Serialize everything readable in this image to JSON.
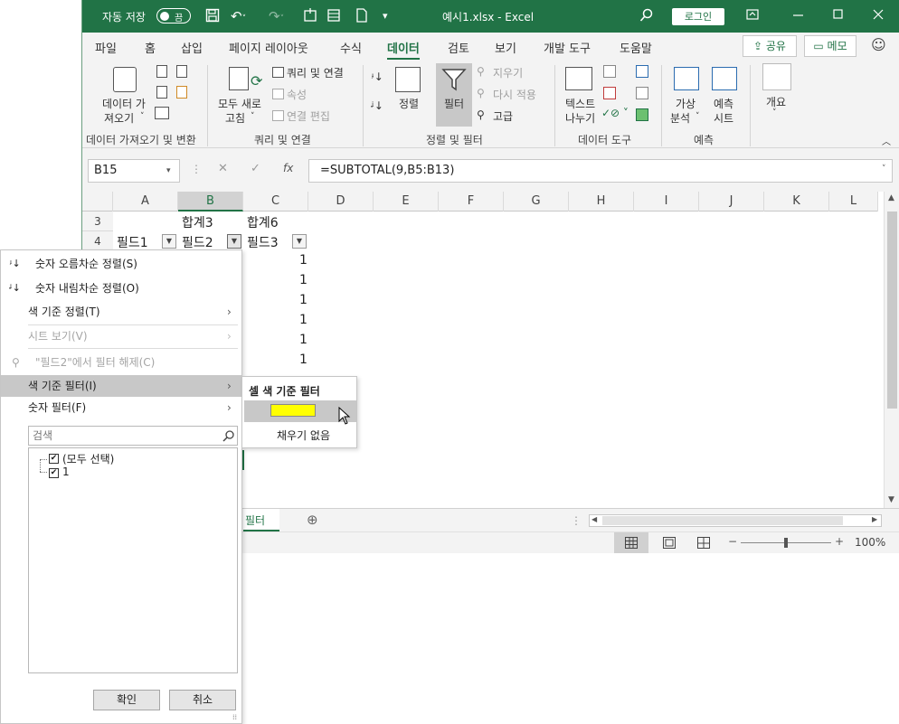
{
  "titlebar": {
    "autosave_label": "자동 저장",
    "autosave_state": "끔",
    "file_title": "예시1.xlsx  -  Excel",
    "login_label": "로그인"
  },
  "menu": {
    "tabs": [
      "파일",
      "홈",
      "삽입",
      "페이지 레이아웃",
      "수식",
      "데이터",
      "검토",
      "보기",
      "개발 도구",
      "도움말"
    ],
    "active_tab": "데이터",
    "share_label": "공유",
    "memo_label": "메모"
  },
  "ribbon": {
    "get_data_label_1": "데이터 가",
    "get_data_label_2": "져오기",
    "refresh_label_1": "모두 새로",
    "refresh_label_2": "고침",
    "queries_label": "쿼리 및 연결",
    "properties_label": "속성",
    "edit_links_label": "연결 편집",
    "sort_label": "정렬",
    "filter_label": "필터",
    "clear_label": "지우기",
    "reapply_label": "다시 적용",
    "advanced_label": "고급",
    "text_to_columns_1": "텍스트",
    "text_to_columns_2": "나누기",
    "whatif_1": "가상",
    "whatif_2": "분석",
    "forecast_1": "예측",
    "forecast_2": "시트",
    "outline_label": "개요",
    "groups": {
      "get_transform": "데이터 가져오기 및 변환",
      "queries": "쿼리 및 연결",
      "sort_filter": "정렬 및 필터",
      "data_tools": "데이터 도구",
      "forecast": "예측"
    }
  },
  "formula_bar": {
    "name_box": "B15",
    "formula": "=SUBTOTAL(9,B5:B13)"
  },
  "grid": {
    "columns": [
      "A",
      "B",
      "C",
      "D",
      "E",
      "F",
      "G",
      "H",
      "I",
      "J",
      "K",
      "L"
    ],
    "row_numbers": [
      "3",
      "4"
    ],
    "row3": {
      "B": "합계3",
      "C": "합계6"
    },
    "row4": {
      "A": "필드1",
      "B": "필드2",
      "C": "필드3"
    },
    "c_values": [
      "1",
      "1",
      "1",
      "1",
      "1",
      "1"
    ]
  },
  "sheet": {
    "tab_name": "필터",
    "zoom": "100%"
  },
  "filter_menu": {
    "sort_asc": "숫자 오름차순 정렬(S)",
    "sort_desc": "숫자 내림차순 정렬(O)",
    "sort_by_color": "색 기준 정렬(T)",
    "sheet_view": "시트 보기(V)",
    "clear_filter": "\"필드2\"에서 필터 해제(C)",
    "filter_by_color": "색 기준 필터(I)",
    "number_filters": "숫자 필터(F)",
    "search_placeholder": "검색",
    "select_all": "(모두 선택)",
    "item_1": "1",
    "ok": "확인",
    "cancel": "취소"
  },
  "color_submenu": {
    "header": "셀 색 기준 필터",
    "swatch_color": "#ffff00",
    "no_fill": "채우기 없음"
  },
  "colors": {
    "excel_green": "#217346",
    "ribbon_bg": "#f3f3f3",
    "highlight": "#c8c8c8"
  }
}
